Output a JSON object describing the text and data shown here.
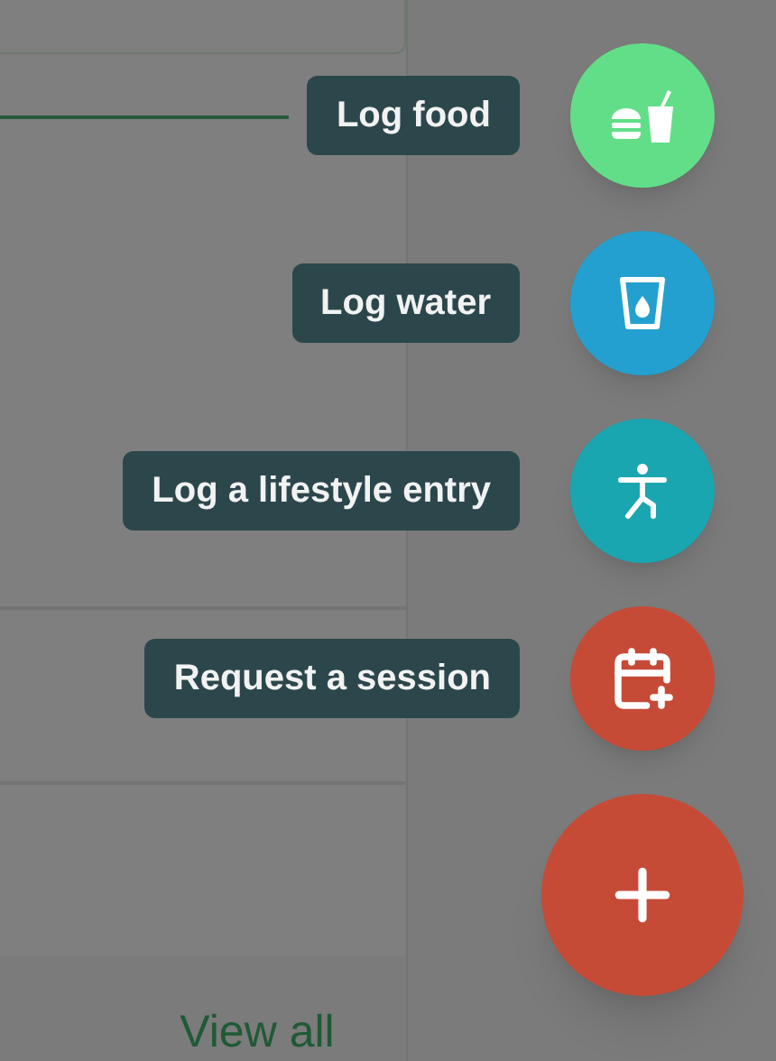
{
  "actions": [
    {
      "label": "Log food",
      "kind": "food",
      "color": "#62de89"
    },
    {
      "label": "Log water",
      "kind": "water",
      "color": "#23a0cf"
    },
    {
      "label": "Log a lifestyle entry",
      "kind": "lifestyle",
      "color": "#1aa6b0"
    },
    {
      "label": "Request a session",
      "kind": "session",
      "color": "#c64b37"
    }
  ],
  "main_button": {
    "color": "#c64b37"
  },
  "background": {
    "link": "View all"
  }
}
